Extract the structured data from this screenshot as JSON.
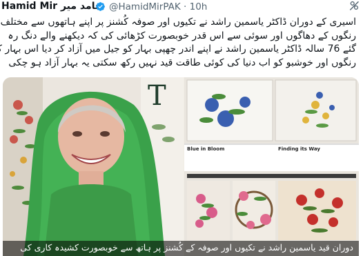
{
  "tweet": {
    "author_name": "Hamid Mir",
    "author_name_urdu": "حامد میر",
    "handle": "@HamidMirPAK",
    "separator": "·",
    "time": "10h",
    "verified_color": "#1d9bf0",
    "text_lines": [
      "اسیری کے دوران ڈاکٹر یاسمین راشد نے تکیوں اور صوفہ کُشنز پر اپنے ہاتھوں سے مختلف",
      "رنگوں کے دھاگوں اور سوئی سے اس قدر خوبصورت کڑھائی کی کہ دیکھنے والے دنگ رہ",
      "گئے 76 سالہ ڈاکٹر یاسمین راشد نے اپنے اندر چھپی بہار کو جیل میں آزاد کر دیا اس بہار کے",
      "رنگوں اور خوشبو کو اب دنیا کی کوئی طاقت قید نہیں رکھ سکتی یہ بہار آزاد ہو چکی"
    ]
  },
  "media": {
    "caption": "دوران قید یاسمین راشد نے تکیوں اور صوفہ کے کُشنز پر ہاتھ سے خوبصورت کشیدہ کاری کی",
    "panels": {
      "blue_in_bloom": "Blue in Bloom",
      "finding_its_way": "Finding its Way",
      "big_letter": "T"
    }
  },
  "icons": {
    "verified": "verified-badge-icon",
    "more": "more-options-icon"
  }
}
